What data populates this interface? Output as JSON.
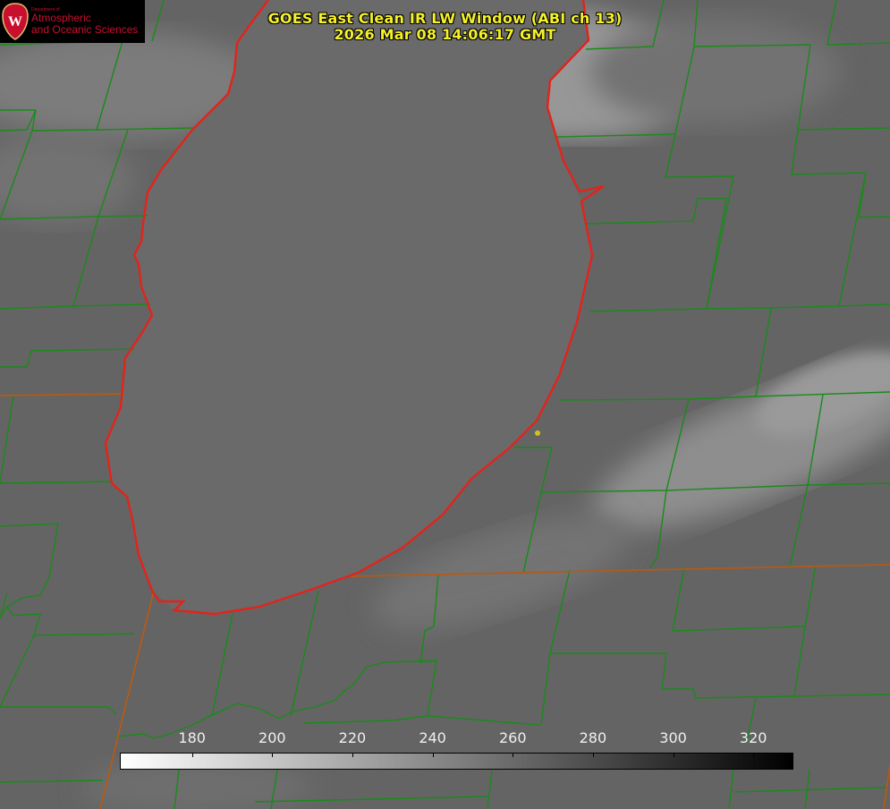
{
  "title": {
    "line1": "GOES East Clean IR LW Window (ABI ch 13)",
    "line2": "2026 Mar 08 14:06:17 GMT"
  },
  "logo": {
    "dept_small": "Department of",
    "line1": "Atmospheric",
    "line2": "and Oceanic Sciences",
    "seal_letter": "W"
  },
  "colorbar": {
    "units": "",
    "min": 162,
    "max": 330,
    "ticks": [
      180,
      200,
      220,
      240,
      260,
      280,
      300,
      320
    ],
    "colormap": "white-to-black (grayscale, inverted)"
  },
  "map": {
    "feature": "lake",
    "colors": {
      "county_lines": "#1a8a1a",
      "lake_outline": "#e3231b",
      "state_lines": "#b35a18",
      "station_marker": "#d4c21a",
      "background_gray": "#646464"
    },
    "icons": [
      "seal-icon",
      "station-dot-icon"
    ]
  }
}
